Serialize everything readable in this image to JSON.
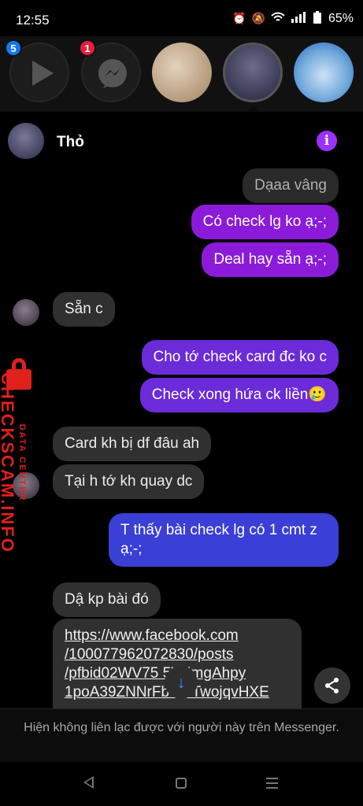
{
  "status_bar": {
    "time": "12:55",
    "battery": "65%",
    "icons": [
      "alarm-icon",
      "mute-icon",
      "wifi-icon",
      "signal-icon",
      "battery-icon"
    ]
  },
  "chat_heads": {
    "play_badge": "5",
    "messenger_badge": "1"
  },
  "conversation": {
    "contact_name": "Thỏ",
    "info_icon": "i"
  },
  "messages": [
    {
      "from": "me",
      "text": "Dạaa vâng"
    },
    {
      "from": "me",
      "text": "Có check lg ko ạ;-;"
    },
    {
      "from": "me",
      "text": "Deal hay sẵn ạ;-;"
    },
    {
      "from": "them",
      "text": "Sẵn c"
    },
    {
      "from": "me",
      "text": "Cho tớ check card đc ko c"
    },
    {
      "from": "me",
      "text": "Check xong hứa ck liền🥲"
    },
    {
      "from": "them",
      "text": "Card kh bị df đâu ah"
    },
    {
      "from": "them",
      "text": "Tại h tớ kh quay dc"
    },
    {
      "from": "me",
      "text": "T thấy bài check lg có 1 cmt z ạ;-;"
    },
    {
      "from": "them",
      "text": "Dậ kp bài đó"
    },
    {
      "from": "them",
      "text": "https://www.facebook.com/100077962072830/posts/pfbid02WV75▢5VKmgAhpy1poA39ZNNrFb▢2BTwojqvHXE"
    }
  ],
  "link_lines": [
    "https://www.facebook.com",
    "/100077962072830/posts",
    "/pfbid02WV75      5VKmgAhpy",
    "1poA39ZNNrFb    2BTwojqvHXE"
  ],
  "watermark": {
    "top": "DATA CENTER",
    "main": "CHECKSCAM.INFO"
  },
  "notice": "Hiện không liên lạc được với người này trên Messenger.",
  "colors": {
    "bubble_in": "#303030",
    "bubble_out_purple": "#8c1bd9",
    "bubble_out_blue": "#3a3fd6",
    "info_accent": "#9b30ff",
    "watermark_red": "#e0201b"
  }
}
